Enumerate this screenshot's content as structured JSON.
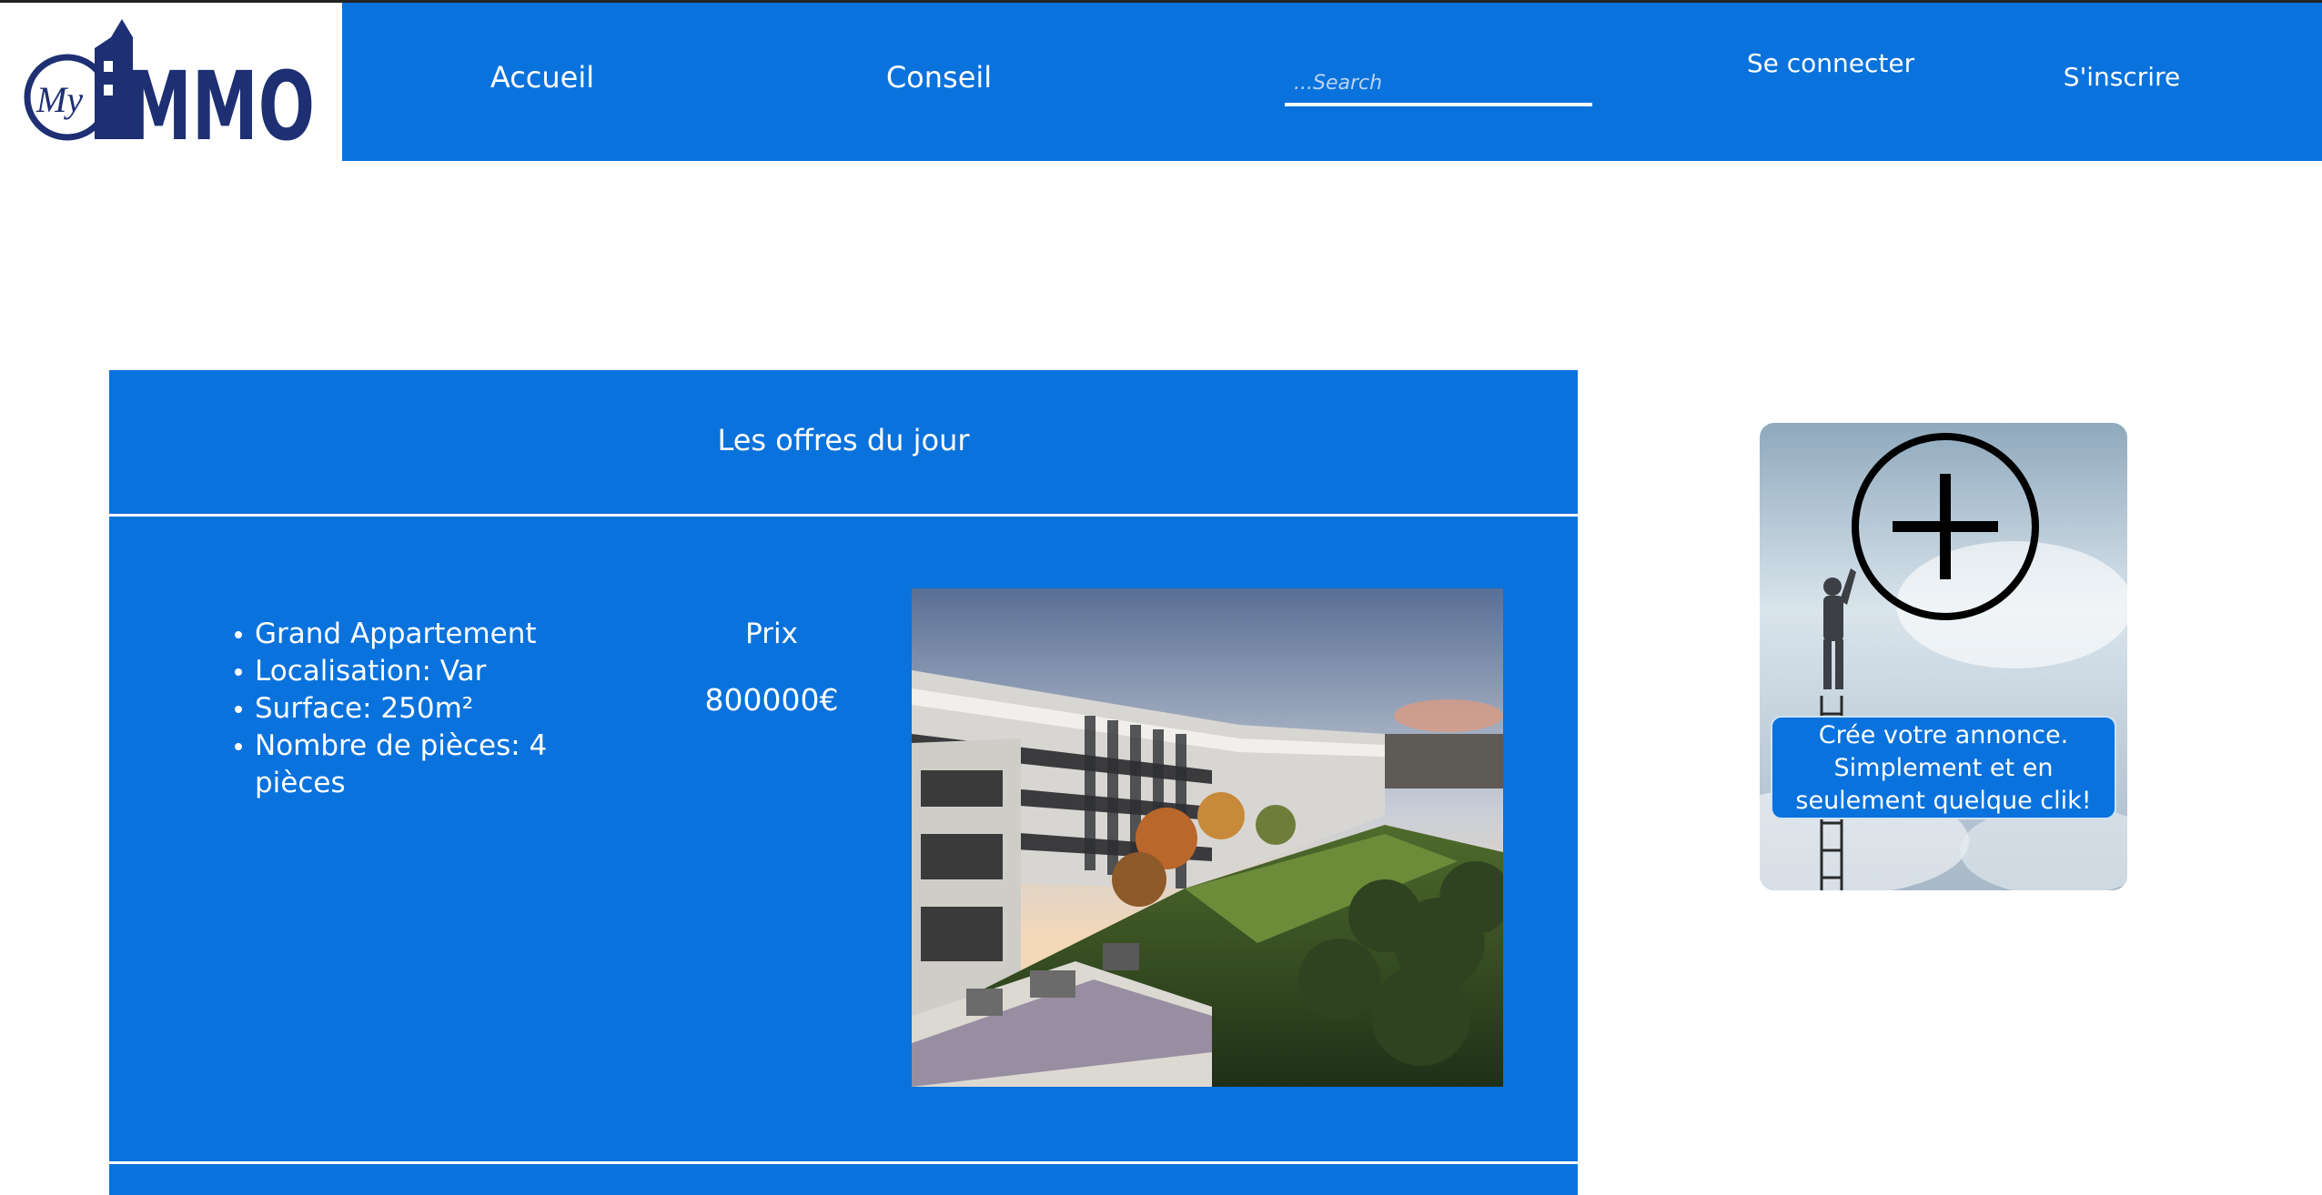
{
  "colors": {
    "brand_blue": "#0972dc",
    "white": "#ffffff",
    "logo_navy": "#1e2f74"
  },
  "header": {
    "logo": {
      "prefix": "My",
      "name": "IMMO"
    },
    "nav": {
      "home": "Accueil",
      "advice": "Conseil",
      "login": "Se connecter",
      "signup": "S'inscrire"
    },
    "search": {
      "placeholder": "...Search",
      "value": ""
    }
  },
  "offers": {
    "title": "Les offres du jour",
    "listing": {
      "features": [
        "Grand Appartement",
        "Localisation: Var",
        "Surface: 250m²",
        "Nombre de pièces: 4 pièces"
      ],
      "price_label": "Prix",
      "price": "800000€"
    }
  },
  "create_ad": {
    "icon": "plus-circle-icon",
    "message": "Crée votre annonce. Simplement et en seulement quelque clik!"
  }
}
